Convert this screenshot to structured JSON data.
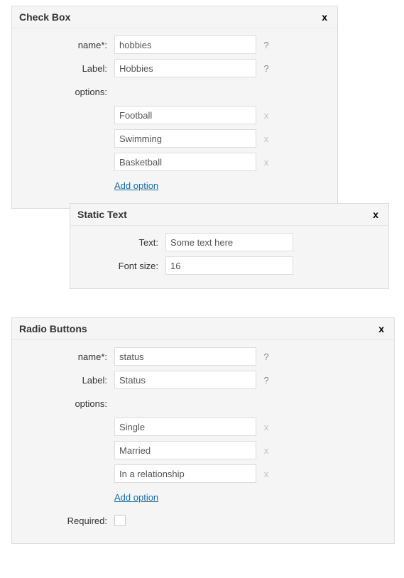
{
  "panels": {
    "checkbox": {
      "title": "Check Box",
      "labels": {
        "name": "name*:",
        "label": "Label:",
        "options": "options:"
      },
      "hint": "?",
      "remove": "x",
      "close": "x",
      "values": {
        "name": "hobbies",
        "label": "Hobbies"
      },
      "options": [
        "Football",
        "Swimming",
        "Basketball"
      ],
      "add_option": "Add option"
    },
    "statictext": {
      "title": "Static Text",
      "close": "x",
      "labels": {
        "text": "Text:",
        "font_size": "Font size:"
      },
      "values": {
        "text": "Some text here",
        "font_size": "16"
      }
    },
    "radio": {
      "title": "Radio Buttons",
      "close": "x",
      "labels": {
        "name": "name*:",
        "label": "Label:",
        "options": "options:",
        "required": "Required:"
      },
      "hint": "?",
      "remove": "x",
      "values": {
        "name": "status",
        "label": "Status"
      },
      "options": [
        "Single",
        "Married",
        "In a relationship"
      ],
      "add_option": "Add option"
    }
  }
}
